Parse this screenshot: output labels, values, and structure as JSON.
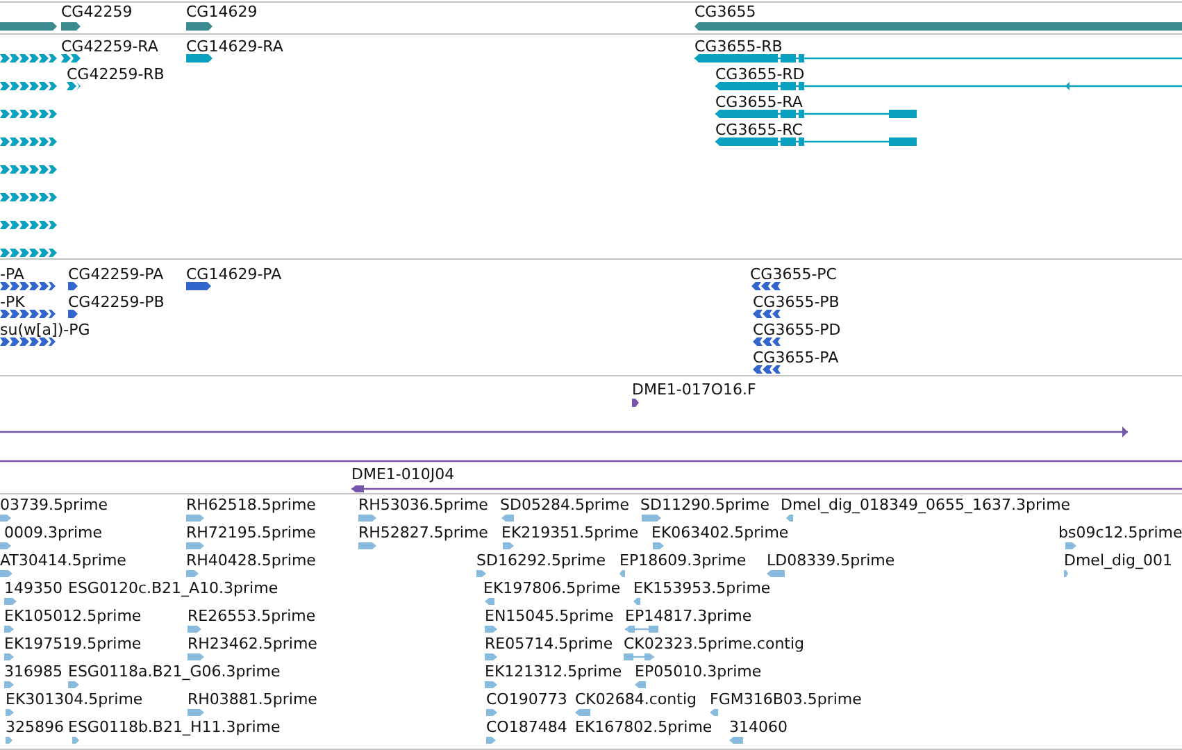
{
  "tracks": [
    {
      "kind": "gene",
      "features": [
        {
          "reverse": false
        },
        {
          "label": "CG42259",
          "reverse": false
        },
        {
          "label": "CG14629",
          "reverse": false
        },
        {
          "label": "CG3655",
          "reverse": true
        }
      ]
    },
    {
      "kind": "transcript",
      "features": [
        {
          "reverse": false
        },
        {
          "reverse": false
        },
        {
          "reverse": false
        },
        {
          "reverse": false
        },
        {
          "reverse": false
        },
        {
          "reverse": false
        },
        {
          "reverse": false
        },
        {
          "reverse": false
        },
        {
          "label": "CG42259-RA",
          "reverse": false
        },
        {
          "label": "CG42259-RB",
          "reverse": false
        },
        {
          "label": "CG14629-RA",
          "reverse": false
        },
        {
          "label": "CG3655-RB",
          "reverse": true
        },
        {
          "label": "CG3655-RD",
          "reverse": true
        },
        {
          "label": "CG3655-RA",
          "reverse": true
        },
        {
          "label": "CG3655-RC",
          "reverse": true
        }
      ]
    },
    {
      "kind": "protein",
      "features": [
        {
          "label": "-PA",
          "reverse": false
        },
        {
          "label": "-PK",
          "reverse": false
        },
        {
          "label": "su(w[a])-PG",
          "reverse": false
        },
        {
          "label": "CG42259-PA",
          "reverse": false
        },
        {
          "label": "CG42259-PB",
          "reverse": false
        },
        {
          "label": "CG14629-PA",
          "reverse": false
        },
        {
          "label": "CG3655-PC",
          "reverse": true
        },
        {
          "label": "CG3655-PB",
          "reverse": true
        },
        {
          "label": "CG3655-PD",
          "reverse": true
        },
        {
          "label": "CG3655-PA",
          "reverse": true
        }
      ]
    },
    {
      "kind": "clone",
      "features": [
        {
          "label": "DME1-017O16.F",
          "reverse": false
        },
        {
          "reverse": false
        },
        {
          "reverse": true
        },
        {
          "label": "DME1-010J04",
          "reverse": true
        }
      ]
    },
    {
      "kind": "est",
      "features": [
        {
          "label": "03739.5prime",
          "reverse": false
        },
        {
          "label": "RH62518.5prime",
          "reverse": false
        },
        {
          "label": "RH53036.5prime",
          "reverse": false
        },
        {
          "label": "SD05284.5prime",
          "reverse": true
        },
        {
          "label": "SD11290.5prime",
          "reverse": false
        },
        {
          "label": "Dmel_dig_018349_0655_1637.3prime",
          "reverse": true
        },
        {
          "label": "0009.3prime",
          "reverse": false
        },
        {
          "label": "RH72195.5prime",
          "reverse": false
        },
        {
          "label": "RH52827.5prime",
          "reverse": false
        },
        {
          "label": "EK219351.5prime",
          "reverse": false
        },
        {
          "label": "EK063402.5prime",
          "reverse": false
        },
        {
          "label": "bs09c12.5prime",
          "reverse": false
        },
        {
          "label": "AT30414.5prime",
          "reverse": false
        },
        {
          "label": "RH40428.5prime",
          "reverse": false
        },
        {
          "label": "SD16292.5prime",
          "reverse": false
        },
        {
          "label": "EP18609.3prime",
          "reverse": true
        },
        {
          "label": "LD08339.5prime",
          "reverse": true
        },
        {
          "label": "Dmel_dig_001",
          "reverse": false
        },
        {
          "label": "149350",
          "reverse": false
        },
        {
          "label": "ESG0120c.B21_A10.3prime"
        },
        {
          "label": "EK197806.5prime",
          "reverse": true
        },
        {
          "label": "EK153953.5prime",
          "reverse": true
        },
        {
          "label": "EK105012.5prime",
          "reverse": false
        },
        {
          "label": "RE26553.5prime",
          "reverse": false
        },
        {
          "label": "EN15045.5prime",
          "reverse": false
        },
        {
          "label": "EP14817.3prime",
          "reverse": true
        },
        {
          "label": "EK197519.5prime",
          "reverse": false
        },
        {
          "label": "RH23462.5prime",
          "reverse": false
        },
        {
          "label": "RE05714.5prime",
          "reverse": false
        },
        {
          "label": "CK02323.5prime.contig",
          "reverse": false
        },
        {
          "label": "316985",
          "reverse": false
        },
        {
          "label": "ESG0118a.B21_G06.3prime",
          "reverse": false
        },
        {
          "label": "EK121312.5prime",
          "reverse": false
        },
        {
          "label": "EP05010.3prime",
          "reverse": true
        },
        {
          "label": "EK301304.5prime",
          "reverse": false
        },
        {
          "label": "RH03881.5prime",
          "reverse": false
        },
        {
          "label": "CO190773",
          "reverse": false
        },
        {
          "label": "CK02684.contig",
          "reverse": true
        },
        {
          "label": "FGM316B03.5prime",
          "reverse": true
        },
        {
          "label": "325896",
          "reverse": false
        },
        {
          "label": "ESG0118b.B21_H11.3prime",
          "reverse": false
        },
        {
          "label": "CO187484",
          "reverse": false
        },
        {
          "label": "EK167802.5prime"
        },
        {
          "label": "314060",
          "reverse": true
        }
      ]
    }
  ]
}
